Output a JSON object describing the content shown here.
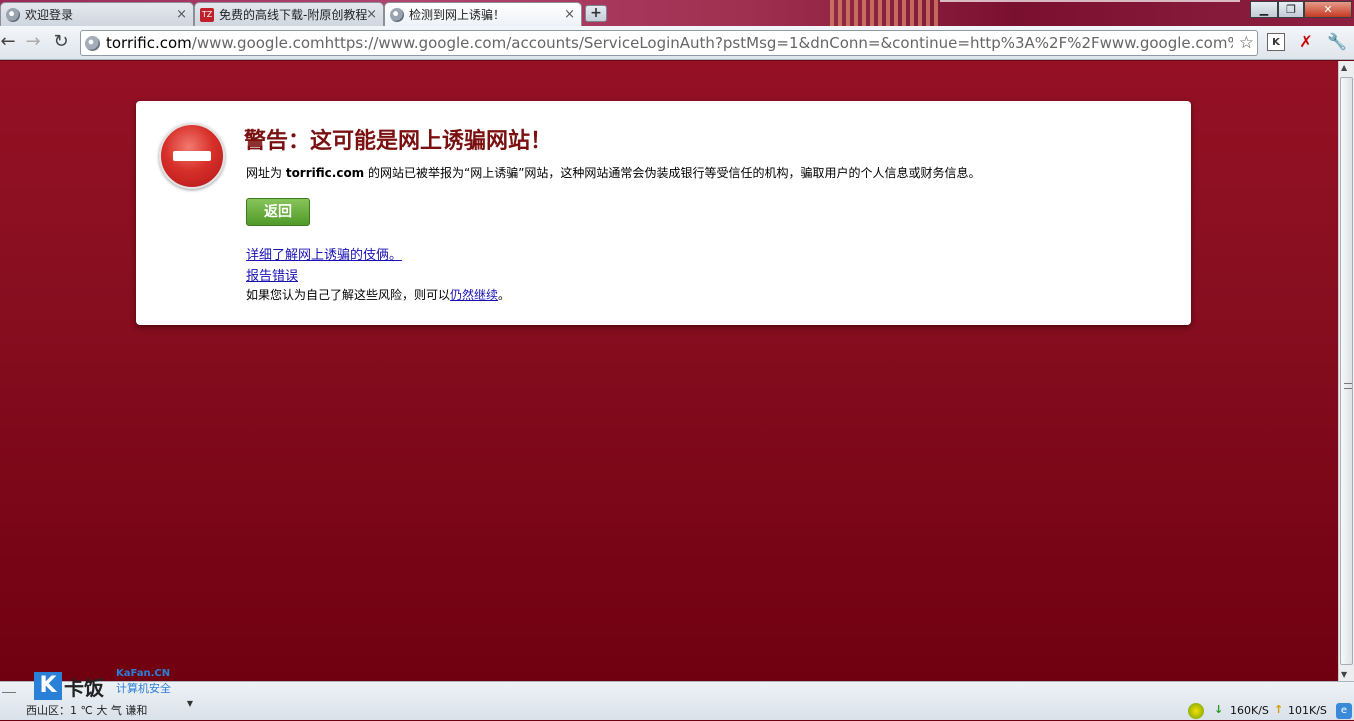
{
  "tabs": [
    {
      "title": "欢迎登录",
      "icon": "globe-icon",
      "active": false
    },
    {
      "title": "免费的高线下载-附原创教程",
      "icon": "site-logo-icon",
      "active": false
    },
    {
      "title": "检测到网上诱骗！",
      "icon": "globe-icon",
      "active": true
    }
  ],
  "tab_close_glyph": "×",
  "new_tab_glyph": "+",
  "site_logo_text": "TZ",
  "window_controls": {
    "minimize": "▁",
    "maximize": "❐",
    "close": "✕"
  },
  "toolbar": {
    "back_glyph": "←",
    "forward_glyph": "→",
    "reload_glyph": "↻",
    "url_host": "torrific.com",
    "url_rest": "/www.google.comhttps://www.google.com/accounts/ServiceLoginAuth?pstMsg=1&dnConn=&continue=http%3A%2F%2Fwww.google.com%",
    "star_glyph": "☆",
    "ext_k": "K",
    "ext_red": "✗",
    "wrench_glyph": "🔧"
  },
  "warning": {
    "title": "警告：这可能是网上诱骗网站！",
    "desc_prefix": "网址为 ",
    "desc_host": "torrific.com",
    "desc_suffix": " 的网站已被举报为“网上诱骗”网站，这种网站通常会伪装成银行等受信任的机构，骗取用户的个人信息或财务信息。",
    "back_button": "返回",
    "learn_more_link": "详细了解网上诱骗的伎俩。",
    "report_error_link": "报告错误",
    "proceed_prefix": "如果您认为自己了解这些风险，则可以",
    "proceed_link": "仍然继续",
    "proceed_suffix": "。"
  },
  "scrollbar": {
    "up": "▲",
    "down": "▼"
  },
  "taskbar": {
    "brand_k": "K",
    "brand_name": "卡饭",
    "brand_url": "KaFan.CN",
    "brand_sub": "计算机安全",
    "weather": "西山区：1 ℃ 大 气 谦和",
    "dropdown_glyph": "▼",
    "down_speed": "160K/S",
    "up_speed": "101K/S",
    "down_arrow": "↓",
    "up_arrow": "↑",
    "ie_glyph": "e"
  },
  "colors": {
    "page_background": "#8c0f22",
    "title_red": "#7a1010",
    "button_green": "#4f9a28",
    "link_blue": "#1a12b4"
  }
}
